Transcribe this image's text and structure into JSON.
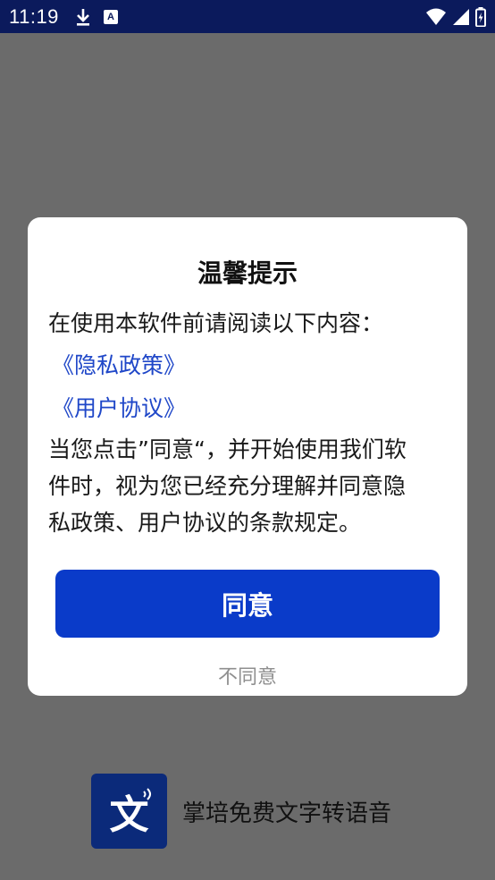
{
  "status_bar": {
    "time": "11:19",
    "icons": [
      "download-icon",
      "a-notification-icon",
      "wifi-icon",
      "signal-icon",
      "battery-icon"
    ]
  },
  "dialog": {
    "title": "温馨提示",
    "intro": "在使用本软件前请阅读以下内容：",
    "privacy_link": "《隐私政策》",
    "terms_link": "《用户协议》",
    "body_lines": [
      "当您点击”同意“，并开始使用我们软",
      "件时，视为您已经充分理解并同意隐",
      "私政策、用户协议的条款规定。"
    ],
    "agree_label": "同意",
    "disagree_label": "不同意"
  },
  "splash": {
    "icon_glyph": "文",
    "app_name": "掌培免费文字转语音"
  },
  "colors": {
    "status_bar_bg": "#0b1a5c",
    "scrim": "#6b6b6b",
    "accent": "#0a3bc9",
    "link": "#1f47c8",
    "app_icon_bg": "#0b2a7a"
  }
}
